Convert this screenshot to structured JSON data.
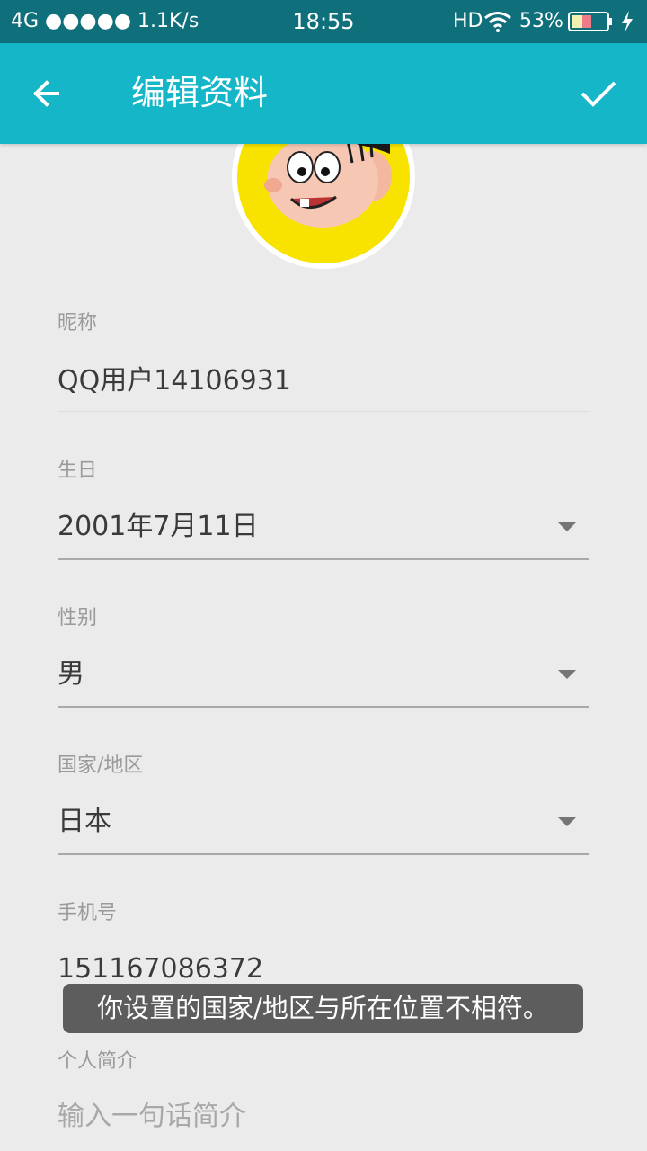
{
  "status_bar": {
    "network": "4G ●●●●● 1.1K/s",
    "time": "18:55",
    "hd": "HD",
    "battery_percent": "53%",
    "battery_level": 0.53,
    "icons": [
      "wifi-icon",
      "battery-icon",
      "charging-icon"
    ]
  },
  "app_bar": {
    "title": "编辑资料",
    "back_icon": "arrow-left-icon",
    "done_icon": "checkmark-icon",
    "color": "#14b6c8"
  },
  "profile": {
    "nickname_label": "昵称",
    "nickname_value": "QQ用户14106931",
    "birthday_label": "生日",
    "birthday_value": "2001年7月11日",
    "gender_label": "性别",
    "gender_value": "男",
    "region_label": "国家/地区",
    "region_value": "日本",
    "phone_label": "手机号",
    "phone_value": "151167086372",
    "bio_label": "个人简介",
    "bio_placeholder": "输入一句话简介"
  },
  "toast": {
    "message": "你设置的国家/地区与所在位置不相符。"
  }
}
